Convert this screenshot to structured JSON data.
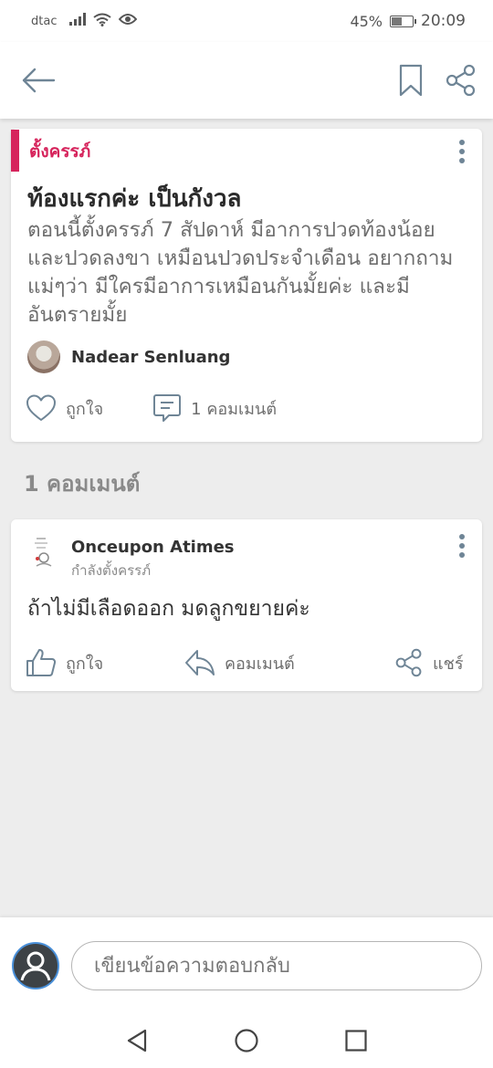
{
  "status_bar": {
    "carrier": "dtac",
    "battery_percent": "45%",
    "time": "20:09",
    "icons": [
      "signal-icon",
      "wifi-icon",
      "eye-icon",
      "battery-icon"
    ]
  },
  "header": {
    "icons": [
      "back-arrow-icon",
      "bookmark-icon",
      "share-icon"
    ]
  },
  "post": {
    "category": "ตั้งครรภ์",
    "title": "ท้องแรกค่ะ เป็นกังวล",
    "body": "ตอนนี้ตั้งครรภ์ 7 สัปดาห์ มีอาการปวดท้องน้อย และปวดลงขา เหมือนปวดประจำเดือน อยากถามแม่ๆว่า มีใครมีอาการเหมือนกันมั้ยค่ะ และมีอันตรายมั้ย",
    "author": "Nadear Senluang",
    "like_label": "ถูกใจ",
    "comment_count_label": "1 คอมเมนต์"
  },
  "comments_heading": "1 คอมเมนต์",
  "comment": {
    "author": "Onceupon Atimes",
    "status": "กำลังตั้งครรภ์",
    "text": "ถ้าไม่มีเลือดออก มดลูกขยายค่ะ",
    "like_label": "ถูกใจ",
    "reply_label": "คอมเมนต์",
    "share_label": "แชร์"
  },
  "reply_bar": {
    "placeholder": "เขียนข้อความตอบกลับ"
  },
  "colors": {
    "accent": "#d6245c",
    "icon": "#6f8596",
    "background": "#ededed"
  }
}
